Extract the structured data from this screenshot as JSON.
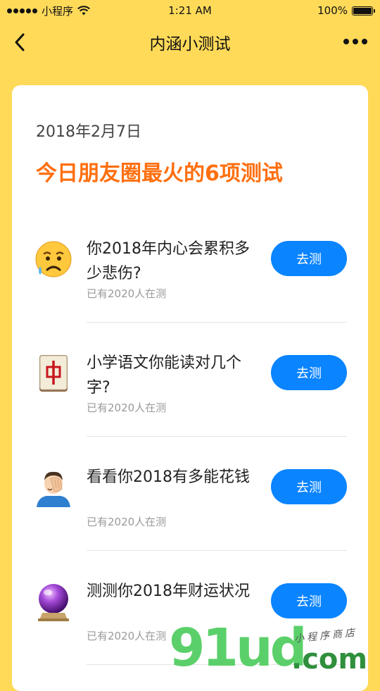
{
  "status_bar": {
    "carrier": "小程序",
    "time": "1:21 AM",
    "battery": "100%"
  },
  "nav": {
    "title": "内涵小测试",
    "back_icon": "chevron-left-icon",
    "more_icon": "more-dots-icon"
  },
  "content": {
    "date": "2018年2月7日",
    "headline": "今日朋友圈最火的6项测试",
    "items": [
      {
        "icon": "sad-face-emoji",
        "title": "你2018年内心会累积多少悲伤?",
        "meta": "已有2020人在测",
        "button": "去测"
      },
      {
        "icon": "mahjong-red-dragon-emoji",
        "title": "小学语文你能读对几个字?",
        "meta": "已有2020人在测",
        "button": "去测"
      },
      {
        "icon": "facepalm-man-emoji",
        "title": "看看你2018有多能花钱",
        "meta": "已有2020人在测",
        "button": "去测"
      },
      {
        "icon": "crystal-ball-emoji",
        "title": "测测你2018年财运状况",
        "meta": "已有2020人在测",
        "button": "去测"
      }
    ]
  },
  "watermark": {
    "main": "91ud",
    "suffix": ".com",
    "tagline": "小程序商店"
  },
  "colors": {
    "background": "#FFDA59",
    "headline": "#FF6F0F",
    "button": "#0A84FF",
    "meta_text": "#999999"
  }
}
